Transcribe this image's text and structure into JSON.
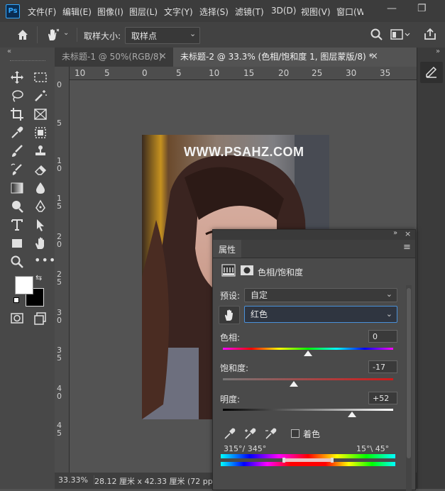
{
  "app": {
    "logo": "Ps"
  },
  "menu": {
    "items": [
      "文件(F)",
      "编辑(E)",
      "图像(I)",
      "图层(L)",
      "文字(Y)",
      "选择(S)",
      "滤镜(T)",
      "3D(D)",
      "视图(V)",
      "窗口(W"
    ],
    "window_controls": {
      "minimize": "—",
      "maximize": "❐"
    }
  },
  "options_bar": {
    "home_icon": "home-icon",
    "tool_icon": "targeted-adjustment-icon",
    "sample_size_label": "取样大小:",
    "sample_size_value": "取样点"
  },
  "tabs": [
    {
      "label": "未标题-1 @ 50%(RGB/8)",
      "active": false,
      "close": "×"
    },
    {
      "label": "未标题-2 @ 33.3% (色相/饱和度 1, 图层蒙版/8) *",
      "active": true,
      "close": "×"
    }
  ],
  "rulers": {
    "top": [
      "10",
      "5",
      "0",
      "5",
      "10",
      "15",
      "20",
      "25",
      "30",
      "35"
    ],
    "left": [
      "0",
      "5",
      "1\n0",
      "1\n5",
      "2\n0",
      "2\n5",
      "3\n0",
      "3\n5",
      "4\n0",
      "4\n5"
    ]
  },
  "photo": {
    "watermark": "WWW.PSAHZ.COM"
  },
  "status_bar": {
    "zoom": "33.33%",
    "doc_size": "28.12 厘米 x 42.33 厘米 (72 ppi)"
  },
  "properties": {
    "tab_label": "属性",
    "panel_title": "色相/饱和度",
    "preset_label": "预设:",
    "preset_value": "自定",
    "channel_value": "红色",
    "hue": {
      "label": "色相:",
      "value": "0"
    },
    "saturation": {
      "label": "饱和度:",
      "value": "-17"
    },
    "lightness": {
      "label": "明度:",
      "value": "+52"
    },
    "colorize_label": "着色",
    "range_left": "315°/ 345°",
    "range_right": "15°\\ 45°"
  },
  "slider_levels": {
    "hue": 0.5,
    "saturation": 0.415,
    "lightness": 0.76
  },
  "colors": {
    "accent": "#31a8ff",
    "bg": "#535353",
    "panel": "#4a4a4a"
  }
}
